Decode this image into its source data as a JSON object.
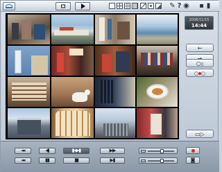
{
  "clock": {
    "date": "2006/11/15",
    "time": "14:44"
  },
  "colors": {
    "accent": "#2f74b5",
    "record": "#e0261e",
    "panel": "#c7d1dc",
    "screen_bg": "#000000"
  },
  "topbar": {
    "layout_options": [
      "single",
      "quad",
      "9-split",
      "16-split"
    ],
    "help_symbol": "?",
    "icons": [
      "logo-icon",
      "stop-icon",
      "play-icon",
      "wrench-icon",
      "help-icon",
      "globe-icon",
      "monitor-icon"
    ]
  },
  "grid": {
    "layout": "4x4",
    "cameras": [
      "clothing-store",
      "beach-market",
      "surf-shop",
      "seaside",
      "storefront-sign",
      "shop-interior-red",
      "shop-interior-red-2",
      "apparel-racks",
      "shop-shelves",
      "dog-in-shop",
      "wetsuit-rack",
      "food-plate",
      "beach-house",
      "surfboards",
      "boardwalk",
      "boutique"
    ]
  },
  "right_panel": {
    "icons": [
      "arrow-left-icon",
      "arrow-right-icon",
      "record-icon",
      "prev-icon",
      "next-icon",
      "switch-icon"
    ]
  },
  "bottom_panel": {
    "icons": [
      "rewind-icon",
      "play-icon",
      "forward-icon",
      "zoom-icon",
      "focus-icon",
      "record-icon",
      "camera-icon"
    ]
  }
}
